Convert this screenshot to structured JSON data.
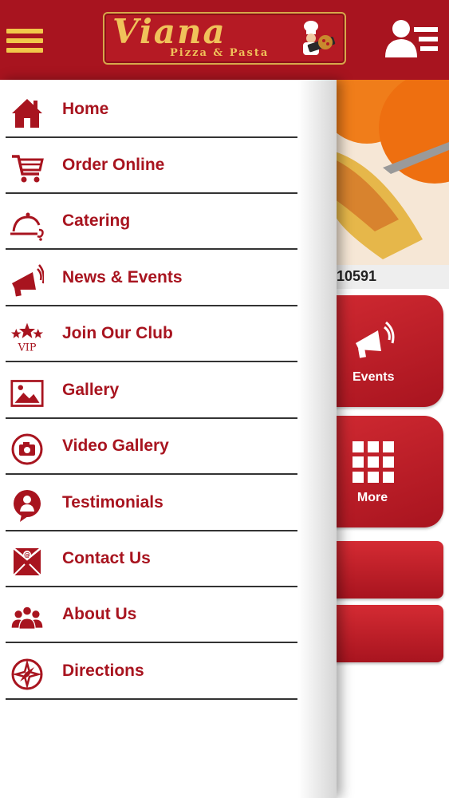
{
  "colors": {
    "brand_red": "#a8141f",
    "gold": "#f1c84a",
    "white": "#ffffff"
  },
  "header": {
    "menu_icon": "hamburger-icon",
    "logo_name": "Viana",
    "logo_subtitle": "Pizza & Pasta",
    "user_icon": "user-menu-icon"
  },
  "background": {
    "phone_fragment": "10591",
    "tiles": [
      {
        "label": "Events",
        "icon": "megaphone-icon"
      },
      {
        "label": "More",
        "icon": "grid-icon"
      }
    ]
  },
  "drawer": {
    "items": [
      {
        "label": "Home",
        "icon": "home-icon"
      },
      {
        "label": "Order Online",
        "icon": "cart-icon"
      },
      {
        "label": "Catering",
        "icon": "catering-icon"
      },
      {
        "label": "News & Events",
        "icon": "megaphone-icon"
      },
      {
        "label": "Join Our Club",
        "icon": "vip-icon"
      },
      {
        "label": "Gallery",
        "icon": "image-icon"
      },
      {
        "label": "Video Gallery",
        "icon": "camera-icon"
      },
      {
        "label": "Testimonials",
        "icon": "testimonial-icon"
      },
      {
        "label": "Contact Us",
        "icon": "envelope-icon"
      },
      {
        "label": "About Us",
        "icon": "group-icon"
      },
      {
        "label": "Directions",
        "icon": "compass-icon"
      }
    ]
  }
}
